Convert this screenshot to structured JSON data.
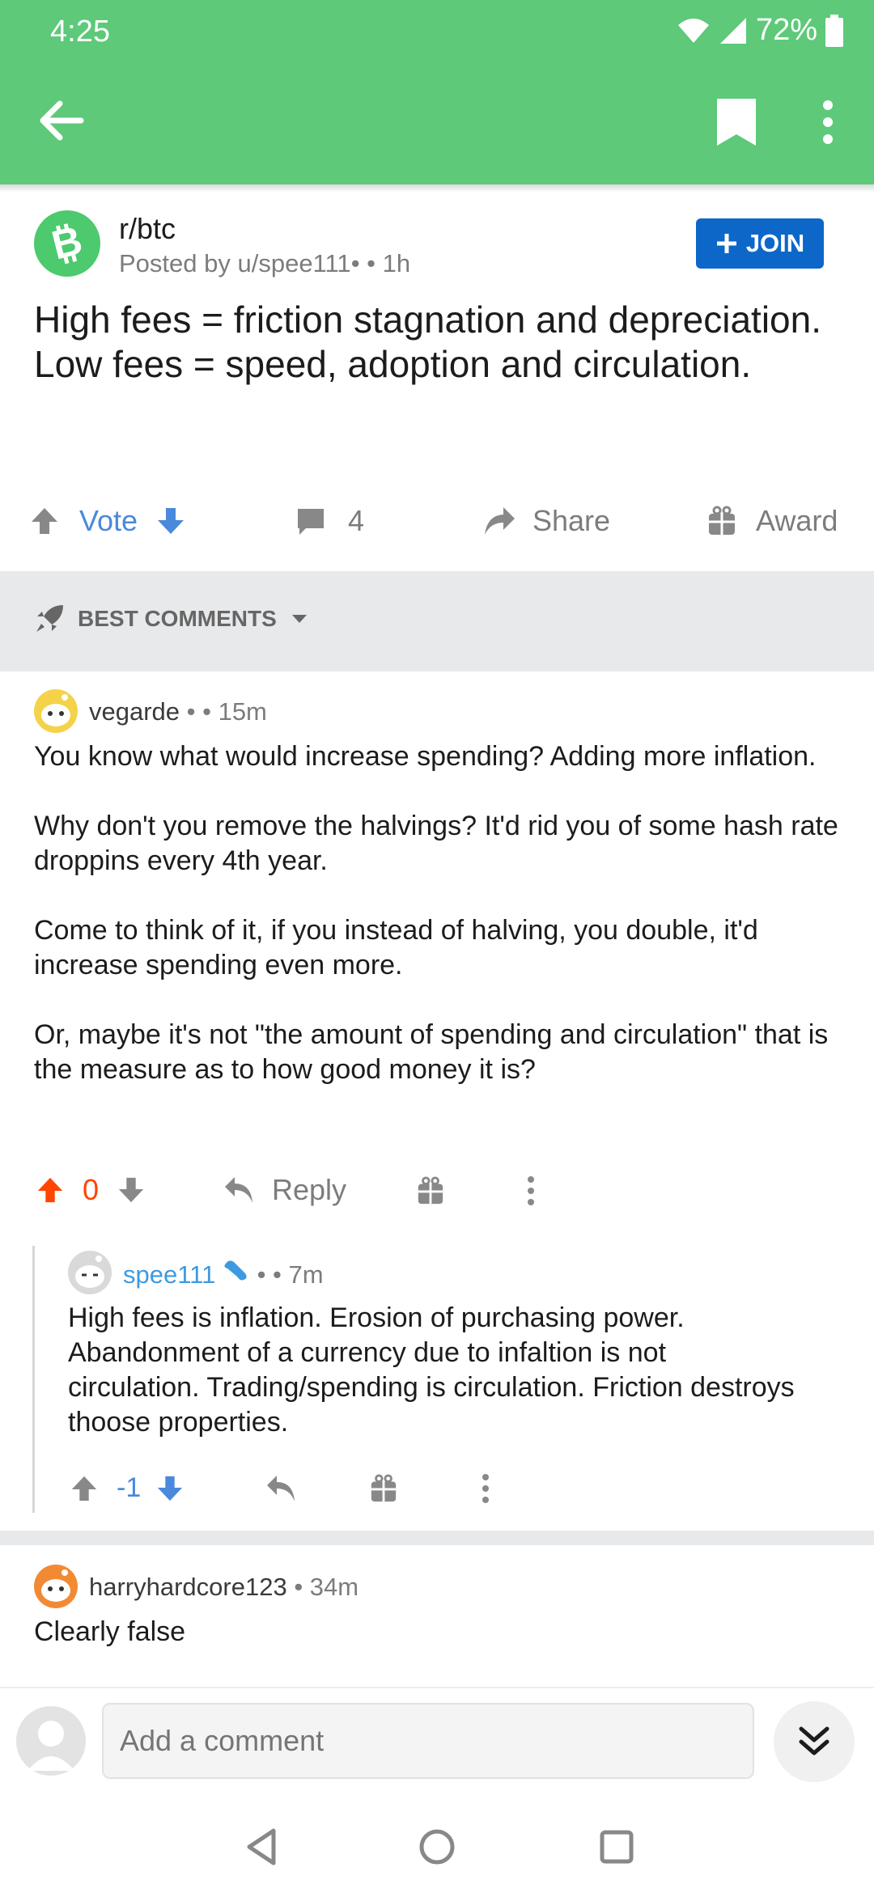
{
  "status": {
    "time": "4:25",
    "battery": "72%"
  },
  "appbar": {
    "back_icon": "arrow-left-icon",
    "bookmark_icon": "bookmark-icon",
    "more_icon": "more-vertical-icon"
  },
  "post": {
    "subreddit": "r/btc",
    "posted_by": "Posted by u/spee111",
    "time": "1h",
    "join_label": "JOIN",
    "title": "High fees = friction stagnation and depreciation. Low fees = speed, adoption and circulation.",
    "vote_label": "Vote",
    "comment_count": "4",
    "share_label": "Share",
    "award_label": "Award"
  },
  "sort": {
    "label": "BEST COMMENTS"
  },
  "comments": [
    {
      "author": "vegarde",
      "time": "15m",
      "paragraphs": [
        "You know what would increase spending? Adding more inflation.",
        "Why don't you remove the halvings? It'd rid you of some hash rate droppins every 4th year.",
        "Come to think of it, if you instead of halving, you double, it'd increase spending even more.",
        "Or, maybe it's not \"the amount of spending and circulation\" that is the measure as to how good money it is?"
      ],
      "score": "0",
      "reply_label": "Reply"
    },
    {
      "author": "spee111",
      "time": "7m",
      "paragraphs": [
        "High fees is inflation. Erosion of purchasing power. Abandonment of a currency due to infaltion is not circulation. Trading/spending is circulation. Friction destroys thoose properties."
      ],
      "score": "-1"
    },
    {
      "author": "harryhardcore123",
      "time": "34m",
      "paragraphs": [
        "Clearly false"
      ]
    }
  ],
  "composer": {
    "placeholder": "Add a comment"
  },
  "colors": {
    "header_green": "#5dc979",
    "join_blue": "#0d67c8",
    "upvote_orange": "#ff4500",
    "downvote_blue": "#4a89dc"
  }
}
